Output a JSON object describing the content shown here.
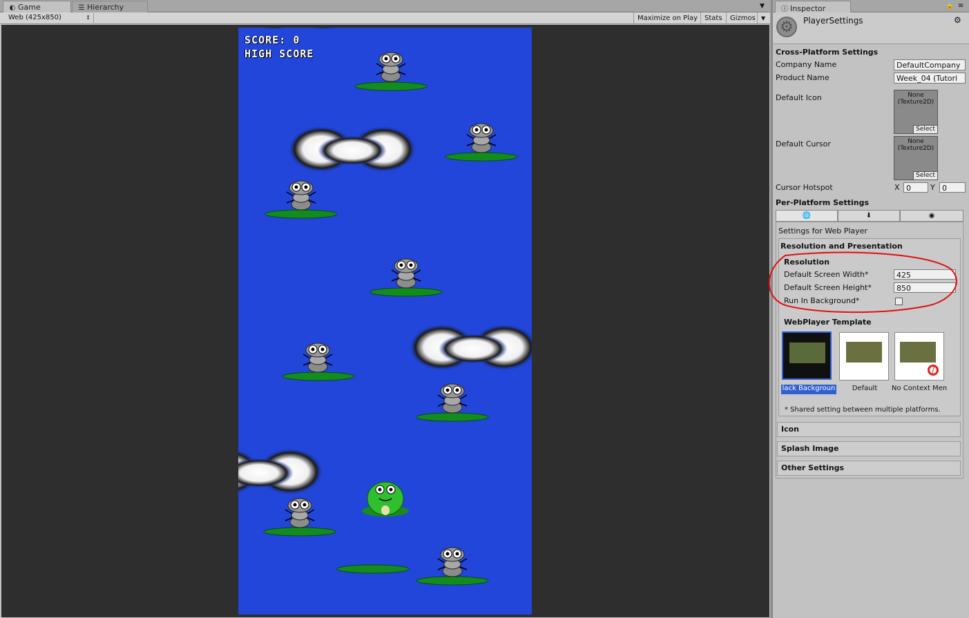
{
  "game_panel": {
    "tabs": [
      {
        "icon": "game-icon",
        "label": "Game"
      },
      {
        "icon": "hierarchy-icon",
        "label": "Hierarchy"
      }
    ],
    "resolution_select": "Web (425x850)",
    "toolbar_buttons": {
      "maximize": "Maximize on Play",
      "stats": "Stats",
      "gizmos": "Gizmos"
    },
    "hud": {
      "score": "SCORE: 0",
      "high_score": "HIGH SCORE"
    }
  },
  "inspector": {
    "tab_label": "Inspector",
    "title": "PlayerSettings",
    "cross_platform": {
      "header": "Cross-Platform Settings",
      "company_name_label": "Company Name",
      "company_name_value": "DefaultCompany",
      "product_name_label": "Product Name",
      "product_name_value": "Week_04 (Tutori",
      "default_icon_label": "Default Icon",
      "default_cursor_label": "Default Cursor",
      "texture_none": "None\n(Texture2D)",
      "select_label": "Select",
      "cursor_hotspot_label": "Cursor Hotspot",
      "hotspot_x_label": "X",
      "hotspot_x_value": "0",
      "hotspot_y_label": "Y",
      "hotspot_y_value": "0"
    },
    "per_platform": {
      "header": "Per-Platform Settings",
      "platform_tabs": [
        "web-icon",
        "standalone-icon",
        "mobile-icon"
      ],
      "settings_for": "Settings for Web Player",
      "resolution_presentation": "Resolution and Presentation",
      "resolution_header": "Resolution",
      "screen_width_label": "Default Screen Width*",
      "screen_width_value": "425",
      "screen_height_label": "Default Screen Height*",
      "screen_height_value": "850",
      "run_in_background_label": "Run In Background*",
      "run_in_background": false,
      "template_header": "WebPlayer Template",
      "templates": [
        {
          "label": "lack Backgroun",
          "selected": true
        },
        {
          "label": "Default",
          "selected": false
        },
        {
          "label": "No Context Men",
          "selected": false
        }
      ],
      "shared_note": "* Shared setting between multiple platforms."
    },
    "sections": {
      "icon": "Icon",
      "splash": "Splash Image",
      "other": "Other Settings"
    }
  },
  "colors": {
    "game_background": "#2146d9",
    "annotation": "#e01010",
    "selection": "#2f5fd0"
  }
}
